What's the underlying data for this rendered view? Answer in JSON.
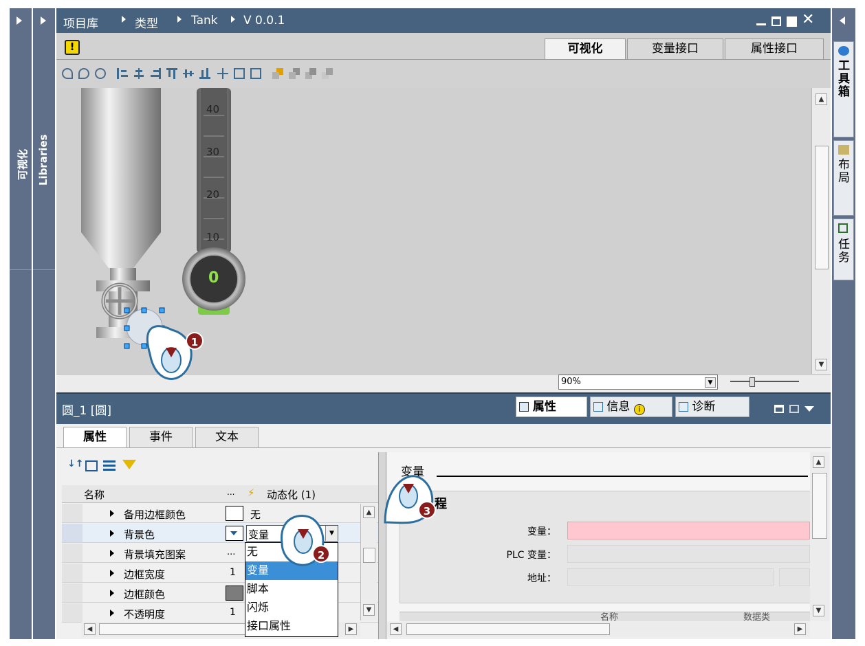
{
  "left_vtabs": [
    "可视化",
    "Libraries"
  ],
  "breadcrumb": [
    "项目库",
    "类型",
    "Tank",
    "V 0.0.1"
  ],
  "window_controls": [
    "minimize",
    "restore",
    "maximize",
    "close"
  ],
  "editor_tabs": [
    {
      "label": "可视化",
      "active": true
    },
    {
      "label": "变量接口",
      "active": false
    },
    {
      "label": "属性接口",
      "active": false
    }
  ],
  "gauge_ticks": [
    "40",
    "30",
    "20",
    "10"
  ],
  "gauge_value": "0",
  "zoom": {
    "value": "90%"
  },
  "right_vtabs": [
    "工具箱",
    "布局",
    "任务"
  ],
  "object_title": "圆_1 [圆]",
  "inspector_tabs": [
    {
      "label": "属性",
      "active": true
    },
    {
      "label": "信息",
      "active": false
    },
    {
      "label": "诊断",
      "active": false
    }
  ],
  "sub_tabs": [
    {
      "label": "属性",
      "active": true
    },
    {
      "label": "事件",
      "active": false
    },
    {
      "label": "文本",
      "active": false
    }
  ],
  "grid": {
    "col_name": "名称",
    "col_dots": "...",
    "col_dyn": "动态化 (1)",
    "rows": [
      {
        "name": "备用边框颜色",
        "value": "",
        "dyn": "无"
      },
      {
        "name": "背景色",
        "value": "",
        "dyn": "变量"
      },
      {
        "name": "背景填充图案",
        "value": "...",
        "dyn": ""
      },
      {
        "name": "边框宽度",
        "value": "1",
        "dyn": ""
      },
      {
        "name": "边框颜色",
        "value": "",
        "dyn": ""
      },
      {
        "name": "不透明度",
        "value": "1",
        "dyn": ""
      }
    ]
  },
  "dropdown_options": [
    "无",
    "变量",
    "脚本",
    "闪烁",
    "接口属性"
  ],
  "dropdown_selected": "变量",
  "detail": {
    "section_title": "变量",
    "subsection": "程",
    "fields": [
      {
        "label": "变量：",
        "color": "#ffc8d0"
      },
      {
        "label": "PLC 变量：",
        "color": "#e4e4e4"
      },
      {
        "label": "地址：",
        "color": "#e4e4e4"
      }
    ],
    "partial_headers": [
      "名称",
      "数据类"
    ]
  },
  "steps": [
    "1",
    "2",
    "3"
  ],
  "colors": {
    "titlebar": "#47627e",
    "sidebar": "#5f6f89",
    "badge": "#8a1c1c",
    "cursor_accent": "#2a6fa0",
    "highlight": "#3a8fd6"
  }
}
